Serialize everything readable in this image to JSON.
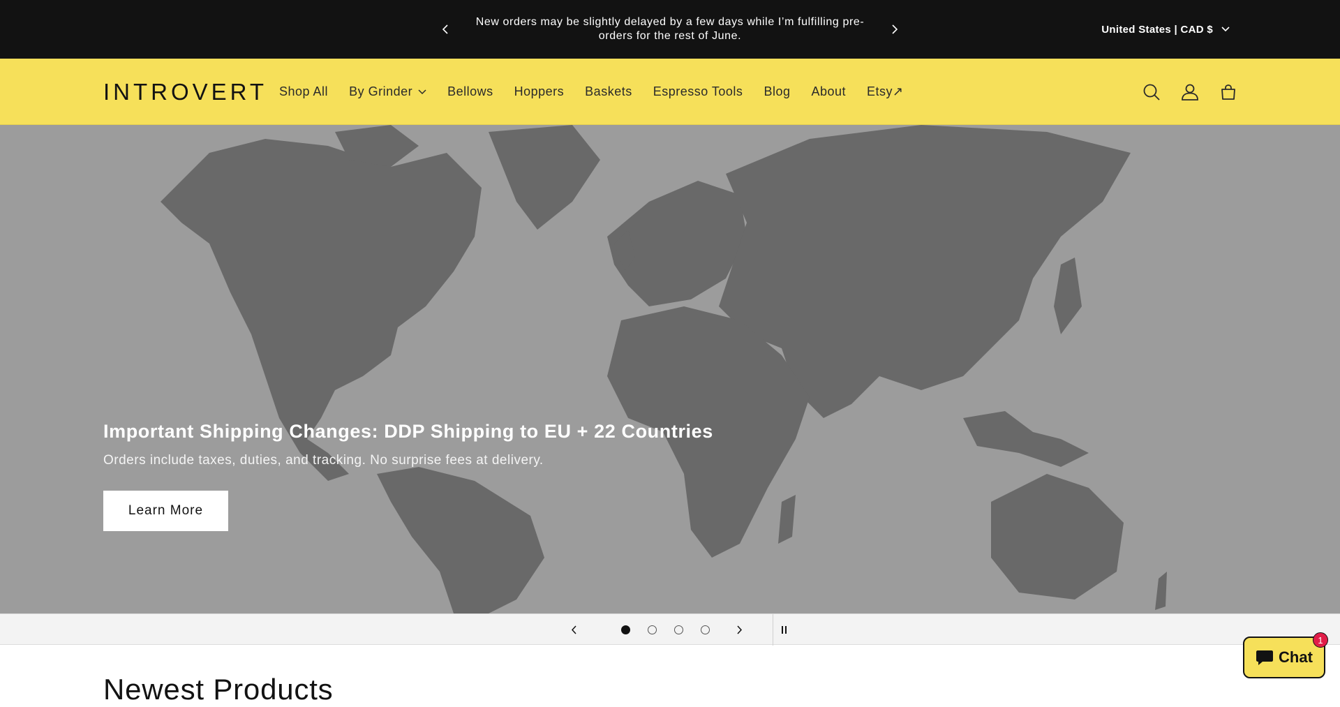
{
  "announcement": {
    "text": "New orders may be slightly delayed by a few days while I’m fulfilling pre-orders for the rest of June.",
    "localization": "United States | CAD $"
  },
  "header": {
    "logo": "INTROVERT",
    "nav": [
      {
        "label": "Shop All"
      },
      {
        "label": "By Grinder"
      },
      {
        "label": "Bellows"
      },
      {
        "label": "Hoppers"
      },
      {
        "label": "Baskets"
      },
      {
        "label": "Espresso Tools"
      },
      {
        "label": "Blog"
      },
      {
        "label": "About"
      },
      {
        "label": "Etsy↗"
      }
    ]
  },
  "hero": {
    "title": "Important Shipping Changes: DDP Shipping to EU + 22 Countries",
    "subtitle": "Orders include taxes, duties, and tracking. No surprise fees at delivery.",
    "button": "Learn More"
  },
  "slider": {
    "slide_count": 4,
    "active_slide": 1
  },
  "section": {
    "heading": "Newest Products"
  },
  "chat": {
    "label": "Chat",
    "badge": "1"
  },
  "colors": {
    "announcement_bg": "#121212",
    "header_bg": "#f6e05a",
    "hero_bg": "#9c9c9c",
    "map_land": "#696969",
    "badge": "#e11d48"
  },
  "icons": {
    "search": "search-icon",
    "account": "account-icon",
    "cart": "cart-icon",
    "chat": "chat-icon"
  }
}
